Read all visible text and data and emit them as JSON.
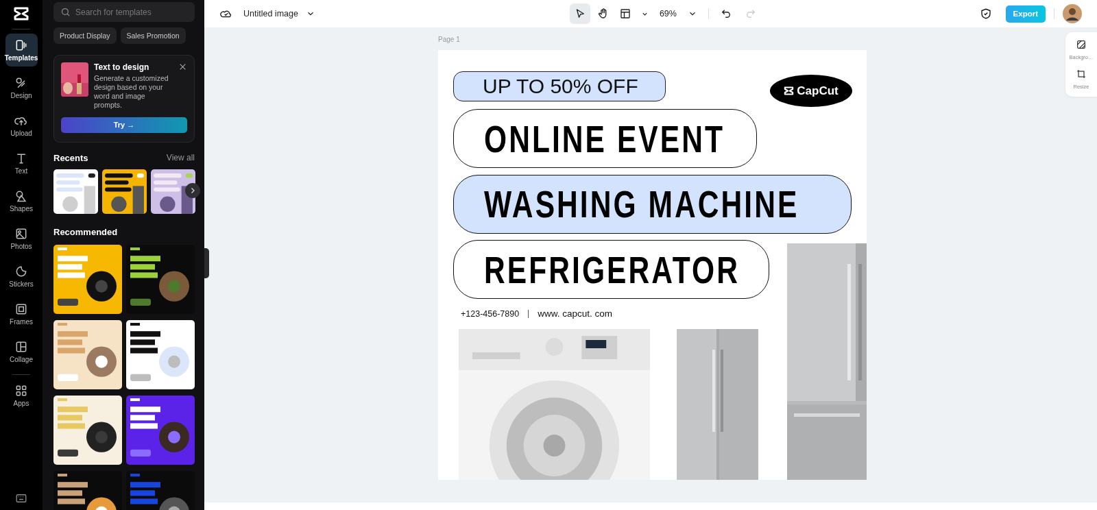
{
  "rail": {
    "items": [
      {
        "label": "Templates",
        "kind": "templates",
        "selected": true
      },
      {
        "label": "Design",
        "kind": "design",
        "selected": false
      },
      {
        "label": "Upload",
        "kind": "upload",
        "selected": false
      },
      {
        "label": "Text",
        "kind": "text",
        "selected": false
      },
      {
        "label": "Shapes",
        "kind": "shapes",
        "selected": false
      },
      {
        "label": "Photos",
        "kind": "photos",
        "selected": false
      },
      {
        "label": "Stickers",
        "kind": "stickers",
        "selected": false
      },
      {
        "label": "Frames",
        "kind": "frames",
        "selected": false
      },
      {
        "label": "Collage",
        "kind": "collage",
        "selected": false
      },
      {
        "label": "Apps",
        "kind": "apps",
        "selected": false
      }
    ]
  },
  "panel": {
    "search": {
      "placeholder": "Search for templates"
    },
    "chips": [
      "Product Display",
      "Sales Promotion"
    ],
    "promo": {
      "title": "Text to design",
      "text": "Generate a customized design based on your word and image prompts.",
      "button": "Try →"
    },
    "recents": {
      "title": "Recents",
      "link": "View all"
    },
    "recommended": {
      "title": "Recommended"
    }
  },
  "topbar": {
    "title": "Untitled image",
    "zoom": "69%",
    "tools": [
      {
        "kind": "select",
        "selected": true
      },
      {
        "kind": "hand",
        "selected": false
      },
      {
        "kind": "layout",
        "selected": false
      }
    ],
    "undo": {
      "disabled": false
    },
    "redo": {
      "disabled": true
    },
    "export": "Export"
  },
  "side_tools": [
    {
      "kind": "background",
      "label": "Backgro…"
    },
    {
      "kind": "resize",
      "label": "Resize"
    }
  ],
  "canvas": {
    "page_label": "Page 1",
    "design": {
      "badge": "UP TO 50% OFF",
      "logo": "CapCut",
      "lines": [
        {
          "text": "ONLINE EVENT",
          "highlighted": false
        },
        {
          "text": "WASHING MACHINE",
          "highlighted": true
        },
        {
          "text": "REFRIGERATOR",
          "highlighted": false
        }
      ],
      "phone": "+123-456-7890",
      "website": "www. capcut. com"
    }
  }
}
